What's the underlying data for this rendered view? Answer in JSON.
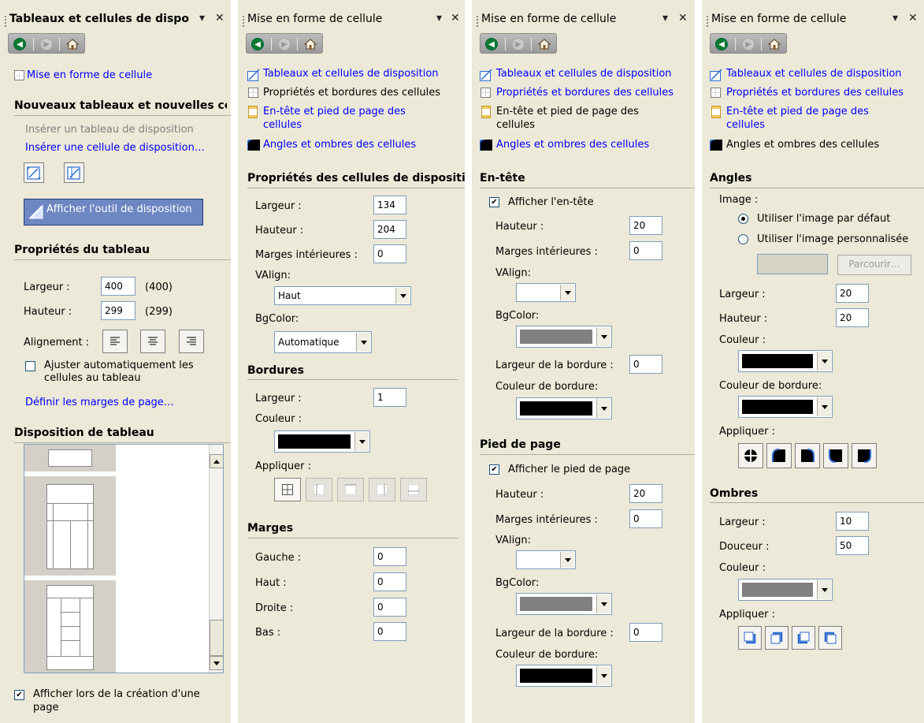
{
  "pane1": {
    "title": "Tableaux et cellules de dispo",
    "link_format": "Mise en forme de cellule",
    "new_header": "Nouveaux tableaux et nouvelles ce",
    "insert_table": "Insérer un tableau de disposition",
    "insert_cell": "Insérer une cellule de disposition…",
    "show_tool": "Afficher l'outil de disposition",
    "props_header": "Propriétés du tableau",
    "width_label": "Largeur :",
    "width_value": "400",
    "width_hint": "(400)",
    "height_label": "Hauteur :",
    "height_value": "299",
    "height_hint": "(299)",
    "align_label": "Alignement :",
    "autofit_line1": "Ajuster automatiquement les",
    "autofit_line2": "cellules au tableau",
    "margins_link": "Définir les marges de page…",
    "layout_header": "Disposition de tableau",
    "show_on_create_line1": "Afficher lors de la création d'une",
    "show_on_create_line2": "page"
  },
  "nav": {
    "links": [
      "Tableaux et cellules de disposition",
      "Propriétés et bordures des cellules",
      "En-tête et pied de page des",
      "cellules",
      "Angles et ombres des cellules"
    ]
  },
  "pane2": {
    "title": "Mise en forme de cellule",
    "props_header": "Propriétés des cellules de dispositi",
    "width_label": "Largeur :",
    "width_value": "134",
    "height_label": "Hauteur :",
    "height_value": "204",
    "padding_label": "Marges intérieures :",
    "padding_value": "0",
    "valign_label": "VAlign:",
    "valign_value": "Haut",
    "bgcolor_label": "BgColor:",
    "bgcolor_value": "Automatique",
    "borders_header": "Bordures",
    "bwidth_label": "Largeur :",
    "bwidth_value": "1",
    "bcolor_label": "Couleur :",
    "apply_label": "Appliquer :",
    "margins_header": "Marges",
    "left_label": "Gauche :",
    "left_value": "0",
    "top_label": "Haut :",
    "top_value": "0",
    "right_label": "Droite :",
    "right_value": "0",
    "bottom_label": "Bas :",
    "bottom_value": "0"
  },
  "pane3": {
    "title": "Mise en forme de cellule",
    "header_header": "En-tête",
    "show_header": "Afficher l'en-tête",
    "height_label": "Hauteur :",
    "height_value": "20",
    "padding_label": "Marges intérieures :",
    "padding_value": "0",
    "valign_label": "VAlign:",
    "bgcolor_label": "BgColor:",
    "bwidth_label": "Largeur de la bordure :",
    "bwidth_value": "0",
    "bcolor_label": "Couleur de bordure:",
    "footer_header": "Pied de page",
    "show_footer": "Afficher le pied de page",
    "f_height_value": "20",
    "f_padding_value": "0",
    "f_bwidth_value": "0"
  },
  "pane4": {
    "title": "Mise en forme de cellule",
    "corners_header": "Angles",
    "image_label": "Image :",
    "default_image": "Utiliser l'image par défaut",
    "custom_image": "Utiliser l'image personnalisée",
    "browse": "Parcourir…",
    "width_label": "Largeur :",
    "width_value": "20",
    "height_label": "Hauteur :",
    "height_value": "20",
    "color_label": "Couleur :",
    "bcolor_label": "Couleur de bordure:",
    "apply_label": "Appliquer :",
    "shadows_header": "Ombres",
    "s_width_label": "Largeur :",
    "s_width_value": "10",
    "softness_label": "Douceur :",
    "softness_value": "50",
    "s_color_label": "Couleur :",
    "s_apply_label": "Appliquer :"
  },
  "colors": {
    "black": "#000000",
    "grey": "#808080",
    "link": "#0000ff",
    "pane": "#ece9d8"
  }
}
